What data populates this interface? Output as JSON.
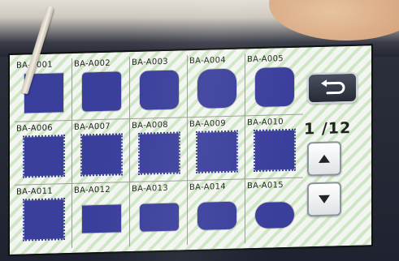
{
  "pattern_grid": {
    "rows": [
      [
        {
          "label": "BA-A001",
          "shape": "sq"
        },
        {
          "label": "BA-A002",
          "shape": "r1"
        },
        {
          "label": "BA-A003",
          "shape": "r2"
        },
        {
          "label": "BA-A004",
          "shape": "r3"
        },
        {
          "label": "BA-A005",
          "shape": "r4"
        }
      ],
      [
        {
          "label": "BA-A006",
          "shape": "zig"
        },
        {
          "label": "BA-A007",
          "shape": "zig"
        },
        {
          "label": "BA-A008",
          "shape": "zig"
        },
        {
          "label": "BA-A009",
          "shape": "zig"
        },
        {
          "label": "BA-A010",
          "shape": "zig"
        }
      ],
      [
        {
          "label": "BA-A011",
          "shape": "zig"
        },
        {
          "label": "BA-A012",
          "shape": "wide"
        },
        {
          "label": "BA-A013",
          "shape": "wide r1"
        },
        {
          "label": "BA-A014",
          "shape": "wide r2"
        },
        {
          "label": "BA-A015",
          "shape": "wide2 r3"
        }
      ]
    ]
  },
  "navigation": {
    "page_indicator": "1 /12",
    "back_icon": "return-arrow-icon",
    "up_icon": "triangle-up-icon",
    "down_icon": "triangle-down-icon"
  },
  "colors": {
    "shape_fill": "#3b3f9c",
    "stripe_light": "#f3f6f0",
    "stripe_green": "#cfe7c6"
  }
}
